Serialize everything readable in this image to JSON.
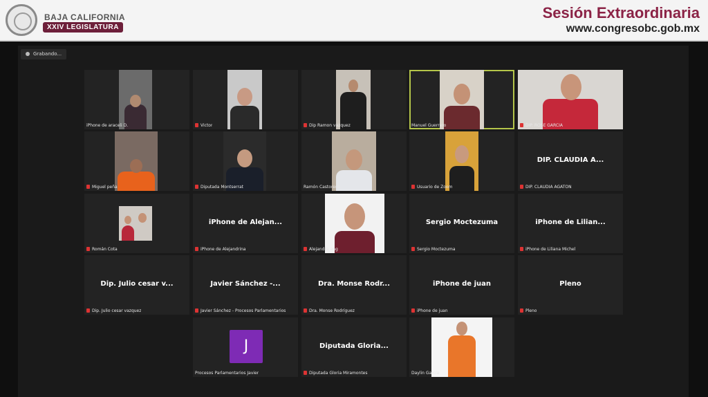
{
  "banner": {
    "logo_line1": "BAJA CALIFORNIA",
    "logo_line2": "XXIV LEGISLATURA",
    "session_title": "Sesión Extraordinaria",
    "website": "www.congresobc.gob.mx"
  },
  "zoom": {
    "recording_label": "Grabando...",
    "active_speaker_color": "#b5c64a",
    "muted_icon_color": "#dd3333",
    "participants": [
      {
        "label": "iPhone de araceli D.",
        "display": "",
        "muted": false
      },
      {
        "label": "Victor",
        "display": "",
        "muted": true
      },
      {
        "label": "Dip Ramon vazquez",
        "display": "",
        "muted": true
      },
      {
        "label": "Manuel Guerrero",
        "display": "",
        "muted": false
      },
      {
        "label": "DIP. ROSE GARCIA",
        "display": "",
        "muted": true
      },
      {
        "label": "Miguel peña",
        "display": "",
        "muted": true
      },
      {
        "label": "Diputada Montserrat",
        "display": "",
        "muted": true
      },
      {
        "label": "Ramón Castorena",
        "display": "",
        "muted": false
      },
      {
        "label": "Usuario de Zoom",
        "display": "",
        "muted": true
      },
      {
        "label": "DIP. CLAUDIA AGATÓN",
        "display": "DIP. CLAUDIA A...",
        "muted": true
      },
      {
        "label": "Román Cota",
        "display": "",
        "muted": true
      },
      {
        "label": "iPhone de Alejandrina",
        "display": "iPhone de Alejan...",
        "muted": true
      },
      {
        "label": "Alejandra ang",
        "display": "",
        "muted": true
      },
      {
        "label": "Sergio Moctezuma",
        "display": "Sergio Moctezuma",
        "muted": true
      },
      {
        "label": "iPhone de Liliana Michel",
        "display": "iPhone de Lilian...",
        "muted": true
      },
      {
        "label": "Dip. Julio cesar vazquez",
        "display": "Dip. Julio cesar v...",
        "muted": true
      },
      {
        "label": "Javier Sánchez - Procesos Parlamentarios",
        "display": "Javier Sánchez -...",
        "muted": true
      },
      {
        "label": "Dra. Monse Rodríguez",
        "display": "Dra. Monse Rodr...",
        "muted": true
      },
      {
        "label": "iPhone de juan",
        "display": "iPhone de juan",
        "muted": true
      },
      {
        "label": "Pleno",
        "display": "Pleno",
        "muted": true
      },
      {
        "label": "Procesos Parlamentarios Javier",
        "display": "",
        "avatar_letter": "J",
        "muted": false
      },
      {
        "label": "Diputada Gloria Miramontes",
        "display": "Diputada Gloria...",
        "muted": true
      },
      {
        "label": "Daylin García",
        "display": "",
        "muted": false
      }
    ]
  }
}
